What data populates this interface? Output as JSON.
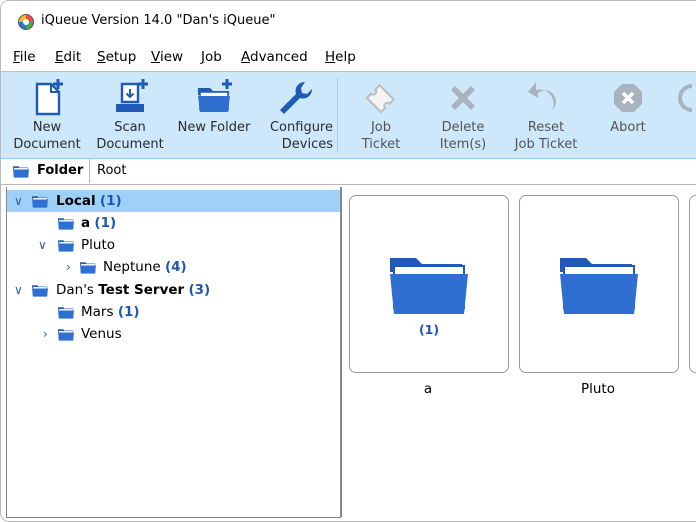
{
  "window": {
    "title": "iQueue Version 14.0 \"Dan's iQueue\""
  },
  "menu": [
    {
      "u": "F",
      "rest": "ile"
    },
    {
      "u": "E",
      "rest": "dit"
    },
    {
      "u": "S",
      "rest": "etup"
    },
    {
      "u": "V",
      "rest": "iew"
    },
    {
      "u": "J",
      "rest": "ob"
    },
    {
      "u": "A",
      "rest": "dvanced"
    },
    {
      "u": "H",
      "rest": "elp"
    }
  ],
  "toolbar": {
    "new_document": [
      "New",
      "Document"
    ],
    "scan_document": [
      "Scan",
      "Document"
    ],
    "new_folder": [
      "New Folder",
      ""
    ],
    "configure_devices": [
      "Configure",
      "Devices"
    ],
    "job_ticket": [
      "Job",
      "Ticket"
    ],
    "delete_items": [
      "Delete",
      "Item(s)"
    ],
    "reset_job_ticket": [
      "Reset",
      "Job Ticket"
    ],
    "abort": [
      "Abort",
      ""
    ]
  },
  "path": {
    "label": "Folder",
    "value": "Root"
  },
  "tree": {
    "local": {
      "name": "Local",
      "count": "(1)"
    },
    "a": {
      "name": "a",
      "count": "(1)"
    },
    "pluto": {
      "name": "Pluto"
    },
    "neptune": {
      "name": "Neptune",
      "count": "(4)"
    },
    "server": {
      "name_a": "Dan's",
      "name_b": "Test Server",
      "count": "(3)"
    },
    "mars": {
      "name": "Mars",
      "count": "(1)"
    },
    "venus": {
      "name": "Venus"
    }
  },
  "content": {
    "items": [
      {
        "label": "a",
        "count": "(1)"
      },
      {
        "label": "Pluto",
        "count": ""
      }
    ]
  },
  "colors": {
    "accent": "#2f6fd1",
    "toolbar_bg": "#cde7fb",
    "selection": "#9fd0f5",
    "count_text": "#1c56b0"
  }
}
